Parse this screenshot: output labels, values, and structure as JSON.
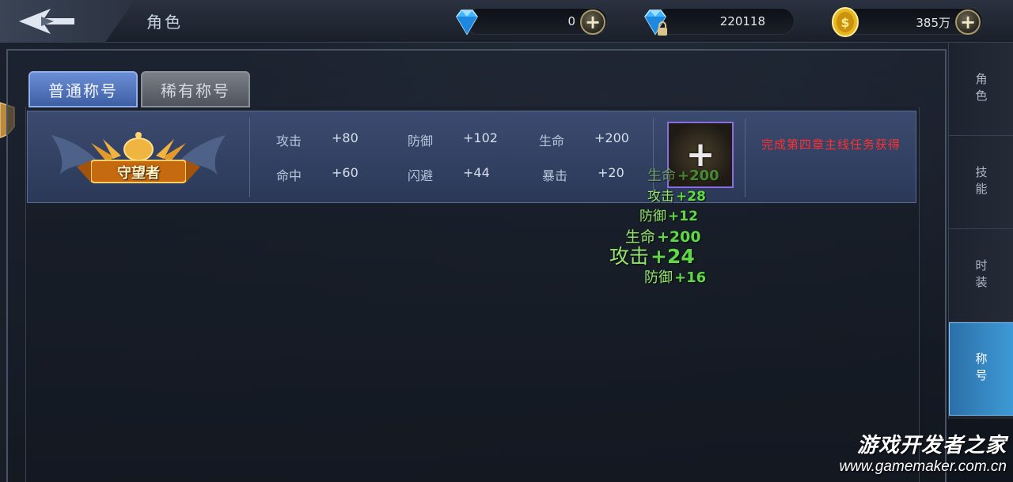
{
  "header": {
    "title": "角色",
    "currencies": [
      {
        "name": "diamond",
        "icon": "diamond-icon",
        "value": "0",
        "has_plus": true
      },
      {
        "name": "bound-diamond",
        "icon": "locked-diamond-icon",
        "value": "220118",
        "has_plus": false
      },
      {
        "name": "gold",
        "icon": "gold-coin-icon",
        "value": "385万",
        "has_plus": true
      }
    ]
  },
  "tabs": [
    {
      "label": "普通称号",
      "active": true
    },
    {
      "label": "稀有称号",
      "active": false
    }
  ],
  "title_entry": {
    "badge_text": "守望者",
    "stats": [
      {
        "label": "攻击",
        "value": "+80"
      },
      {
        "label": "防御",
        "value": "+102"
      },
      {
        "label": "生命",
        "value": "+200"
      },
      {
        "label": "命中",
        "value": "+60"
      },
      {
        "label": "闪避",
        "value": "+44"
      },
      {
        "label": "暴击",
        "value": "+20"
      }
    ],
    "obtain_text": "完成第四章主线任务获得"
  },
  "floating_popups": [
    {
      "label": "生命",
      "value": "+200"
    },
    {
      "label": "攻击",
      "value": "+28"
    },
    {
      "label": "防御",
      "value": "+12"
    },
    {
      "label": "生命",
      "value": "+200"
    },
    {
      "label": "攻击",
      "value": "+24"
    },
    {
      "label": "防御",
      "value": "+16"
    }
  ],
  "sidenav": [
    {
      "label": "角色",
      "active": false
    },
    {
      "label": "技能",
      "active": false
    },
    {
      "label": "时装",
      "active": false
    },
    {
      "label": "称号",
      "active": true
    }
  ],
  "watermark": {
    "line1": "游戏开发者之家",
    "line2": "www.gamemaker.com.cn"
  },
  "colors": {
    "accent_blue": "#3f5fa4",
    "obtain_red": "#ff3030",
    "popup_green": "#62d64a",
    "nav_active": "#3d9ad6"
  }
}
